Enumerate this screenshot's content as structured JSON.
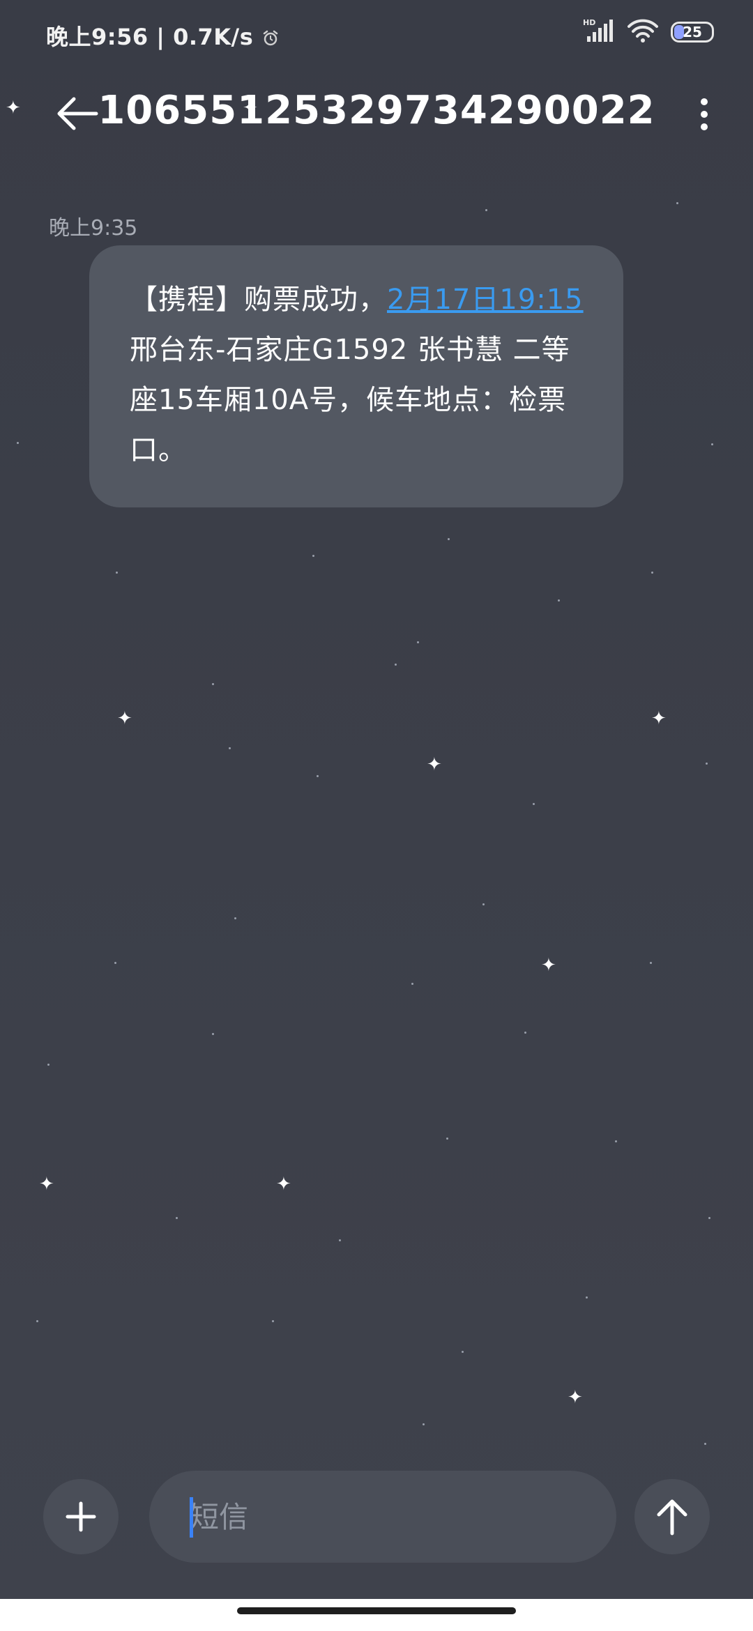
{
  "status_bar": {
    "time_and_speed": "晚上9:56 | 0.7K/s",
    "hd_label": "HD",
    "battery_level": "25"
  },
  "header": {
    "title": "10655125329734290022"
  },
  "conversation": {
    "timestamp": "晚上9:35",
    "message": {
      "prefix": "【携程】购票成功，",
      "date_link": "2月17日19:15",
      "suffix": "邢台东-石家庄G1592 张书慧 二等座15车厢10A号，候车地点：检票口。"
    }
  },
  "input_bar": {
    "placeholder": "短信"
  },
  "colors": {
    "background": "#3c3f49",
    "bubble": "#535862",
    "link": "#3a9bf0",
    "cursor": "#3a82f7",
    "button": "#4a4e58"
  },
  "icons": {
    "back": "arrow-left-icon",
    "more": "more-vertical-icon",
    "add": "plus-icon",
    "send": "arrow-up-icon",
    "alarm": "alarm-icon",
    "signal": "signal-icon",
    "wifi": "wifi-icon",
    "battery": "battery-icon"
  }
}
